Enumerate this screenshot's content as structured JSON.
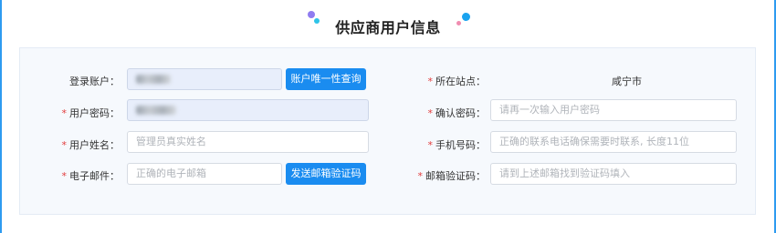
{
  "page": {
    "title": "供应商用户信息",
    "colors": {
      "accent": "#1a8cf0",
      "required": "#e23c3c",
      "panel_bg": "#f6f9fd"
    }
  },
  "form": {
    "login_account": {
      "label": "登录账户：",
      "required": false,
      "value": "(blurred)"
    },
    "check_unique_button": "账户唯一性查询",
    "site": {
      "label": "所在站点：",
      "required": true,
      "value": "咸宁市"
    },
    "password": {
      "label": "用户密码：",
      "required": true,
      "value": "(blurred)"
    },
    "confirm_password": {
      "label": "确认密码：",
      "required": true,
      "placeholder": "请再一次输入用户密码"
    },
    "name": {
      "label": "用户姓名：",
      "required": true,
      "placeholder": "管理员真实姓名"
    },
    "phone": {
      "label": "手机号码：",
      "required": true,
      "placeholder": "正确的联系电话确保需要时联系, 长度11位"
    },
    "email": {
      "label": "电子邮件：",
      "required": true,
      "placeholder": "正确的电子邮箱"
    },
    "send_code_button": "发送邮箱验证码",
    "email_code": {
      "label": "邮箱验证码：",
      "required": true,
      "placeholder": "请到上述邮箱找到验证码填入"
    }
  }
}
